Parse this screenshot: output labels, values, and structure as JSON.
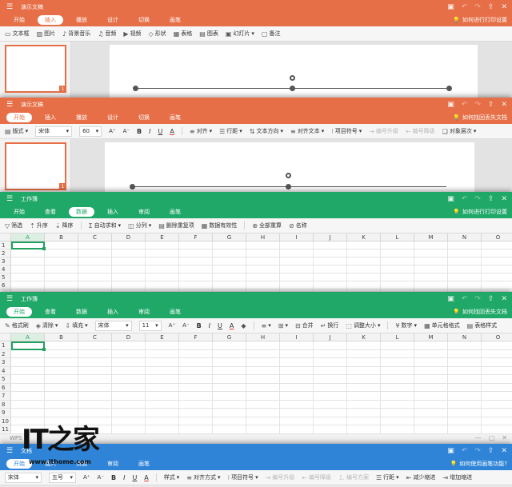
{
  "colors": {
    "presentation": "#e66f47",
    "spreadsheet": "#1fa868",
    "writer": "#2f84d8"
  },
  "ppt1": {
    "title": "演示文稿",
    "tabs": [
      "开始",
      "插入",
      "播放",
      "设计",
      "切换",
      "画笔"
    ],
    "active_tab": 1,
    "help": "如何进行打印设置",
    "tools": [
      "文本框",
      "图片",
      "背景音乐",
      "音频",
      "视频",
      "形状",
      "表格",
      "图表",
      "幻灯片",
      "备注"
    ],
    "slide_number": "1"
  },
  "ppt2": {
    "title": "演示文稿",
    "tabs": [
      "开始",
      "插入",
      "播放",
      "设计",
      "切换",
      "画笔"
    ],
    "active_tab": 0,
    "help": "如何找回丢失文档",
    "tools": {
      "layout": "版式",
      "font": "宋体",
      "size": "60",
      "A_up": "A⁺",
      "A_down": "A⁻",
      "bold": "B",
      "italic": "I",
      "underline": "U",
      "color": "A",
      "align": "对齐",
      "line_spacing": "行距",
      "text_dir": "文本方向",
      "align_text": "对齐文本",
      "bullets": "项目符号",
      "numbering": "编号升级",
      "numbering2": "编号降级",
      "order": "对象层次"
    },
    "slide_number": "1"
  },
  "sheet1": {
    "title": "工作簿",
    "tabs": [
      "开始",
      "查看",
      "数据",
      "插入",
      "审阅",
      "画笔"
    ],
    "active_tab": 2,
    "help": "如何进行打印设置",
    "tools": [
      "筛选",
      "升序",
      "降序",
      "自动求和",
      "分列",
      "删除重复项",
      "数据有效性",
      "全部重算",
      "名称"
    ],
    "columns": [
      "A",
      "B",
      "C",
      "D",
      "E",
      "F",
      "G",
      "H",
      "I",
      "J",
      "K",
      "L",
      "M",
      "N",
      "O"
    ],
    "rows": [
      "1",
      "2",
      "3",
      "4",
      "5",
      "6"
    ]
  },
  "sheet2": {
    "title": "工作簿",
    "tabs": [
      "开始",
      "查看",
      "数据",
      "插入",
      "审阅",
      "画笔"
    ],
    "active_tab": 0,
    "help": "如何找回丢失文档",
    "tools": {
      "format_brush": "格式刷",
      "clear": "清除",
      "fill": "填充",
      "font": "宋体",
      "size": "11",
      "merge": "合并",
      "wrap": "换行",
      "adjust": "调整大小",
      "number": "数字",
      "cell_format": "单元格格式",
      "table_style": "表格样式"
    },
    "columns": [
      "A",
      "B",
      "C",
      "D",
      "E",
      "F",
      "G",
      "H",
      "I",
      "J",
      "K",
      "L",
      "M",
      "N",
      "O"
    ],
    "rows": [
      "1",
      "2",
      "3",
      "4",
      "5",
      "6",
      "7",
      "8",
      "9",
      "10",
      "11"
    ]
  },
  "writer": {
    "wps_label": "WPS",
    "title": "文档",
    "tabs": [
      "开始",
      "插入",
      "页面",
      "审阅",
      "画笔"
    ],
    "active_tab": 0,
    "help": "如何使用画笔功能?",
    "tools": {
      "font": "宋体",
      "size": "五号",
      "style": "样式",
      "align": "对齐方式",
      "bullets": "项目符号",
      "numbering": "编号升级",
      "numbering2": "编号降级",
      "numbering3": "编号方案",
      "line_spacing": "行距",
      "reduce_indent": "减少缩进",
      "add_indent": "增加缩进"
    }
  },
  "watermark": {
    "logo": "IT之家",
    "url": "www.ithome.com"
  }
}
